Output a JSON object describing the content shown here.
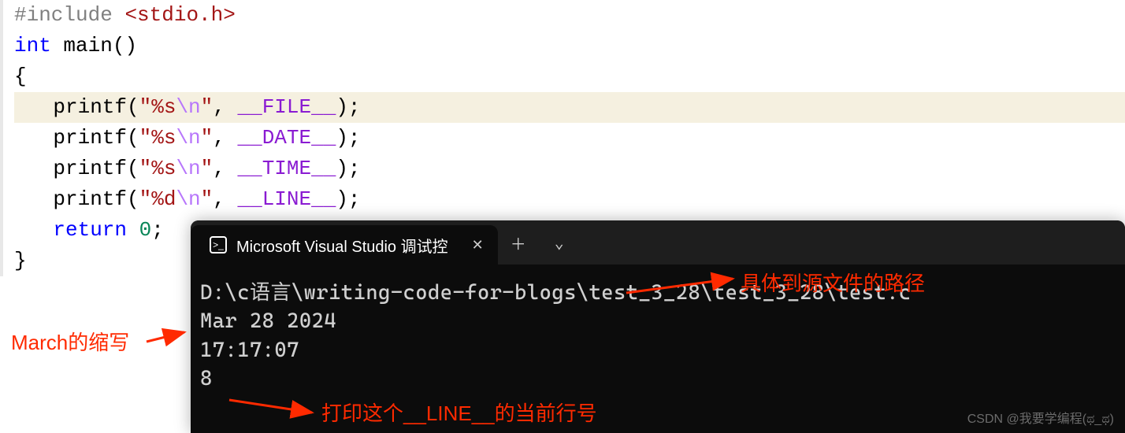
{
  "code": {
    "include_directive": "#include",
    "include_header": "<stdio.h>",
    "kw_int": "int",
    "kw_return": "return",
    "fn_main": "main",
    "fn_printf": "printf",
    "fmt_s": "\"%s",
    "fmt_d": "\"%d",
    "esc_n": "\\n",
    "fmt_close": "\"",
    "macro_file": "__FILE__",
    "macro_date": "__DATE__",
    "macro_time": "__TIME__",
    "macro_line": "__LINE__",
    "zero": "0",
    "comma_sp": ", ",
    "paren_open": "(",
    "paren_close": ")",
    "paren_pair": "()",
    "semi": ";",
    "paren_close_semi": ");",
    "brace_open": "{",
    "brace_close": "}"
  },
  "terminal": {
    "tab_title": "Microsoft Visual Studio 调试控",
    "icon_glyph": ">_",
    "output": {
      "path": "D:\\c语言\\writing-code-for-blogs\\test_3_28\\test_3_28\\test.c",
      "date": "Mar 28 2024",
      "time": "17:17:07",
      "line": "8"
    }
  },
  "annotations": {
    "march": "March的缩写",
    "path": "具体到源文件的路径",
    "line": "打印这个__LINE__的当前行号"
  },
  "watermark": "CSDN @我要学编程(ಥ_ಥ)"
}
